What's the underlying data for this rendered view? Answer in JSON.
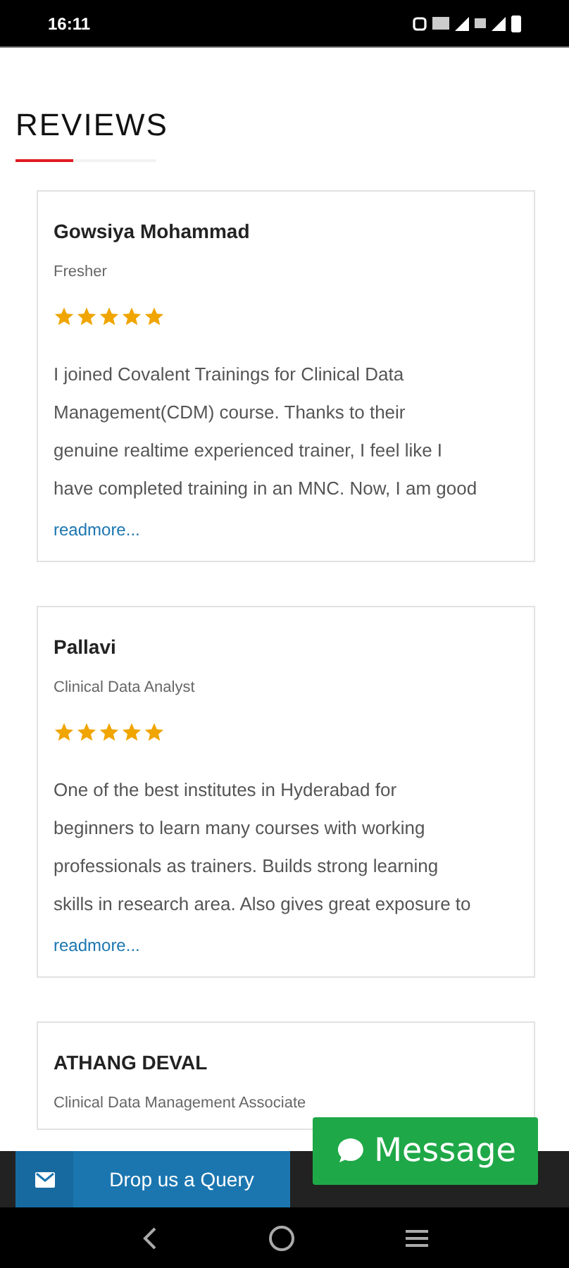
{
  "status_bar": {
    "time": "16:11"
  },
  "section_title": "REVIEWS",
  "reviews": [
    {
      "name": "Gowsiya Mohammad",
      "role": "Fresher",
      "stars": 5,
      "lines": [
        "I joined Covalent Trainings for Clinical Data",
        "Management(CDM) course. Thanks to their",
        "genuine realtime experienced trainer, I feel like I",
        "have completed training in an MNC. Now, I am good"
      ],
      "link": "readmore..."
    },
    {
      "name": "Pallavi",
      "role": "Clinical Data Analyst",
      "stars": 5,
      "lines": [
        "One of the best institutes in Hyderabad for",
        "beginners to learn many courses with working",
        "professionals as trainers. Builds strong learning",
        "skills in research area. Also gives great exposure to"
      ],
      "link": "readmore..."
    },
    {
      "name": "ATHANG DEVAL",
      "role": "Clinical Data Management Associate"
    }
  ],
  "query_button": "Drop us a Query",
  "message_button": "Message"
}
